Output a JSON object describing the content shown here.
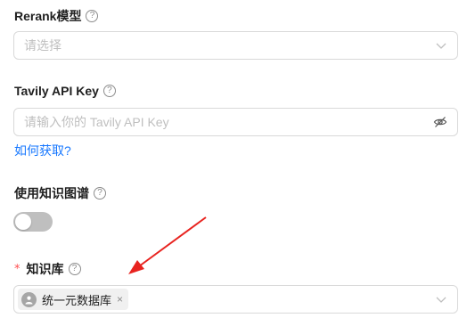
{
  "rerank": {
    "label": "Rerank模型",
    "help": "?",
    "placeholder": "请选择"
  },
  "tavily": {
    "label": "Tavily API Key",
    "help": "?",
    "placeholder": "请输入你的 Tavily API Key",
    "link": "如何获取?"
  },
  "kg": {
    "label": "使用知识图谱",
    "help": "?",
    "enabled": false
  },
  "kb": {
    "required_mark": "*",
    "label": "知识库",
    "help": "?",
    "selected_tags": [
      {
        "label": "统一元数据库",
        "close": "×"
      }
    ]
  },
  "colors": {
    "link": "#1677ff",
    "required": "#ff4d4f",
    "annotation_arrow": "#e8231f",
    "switch_off": "#bfbfbf"
  }
}
